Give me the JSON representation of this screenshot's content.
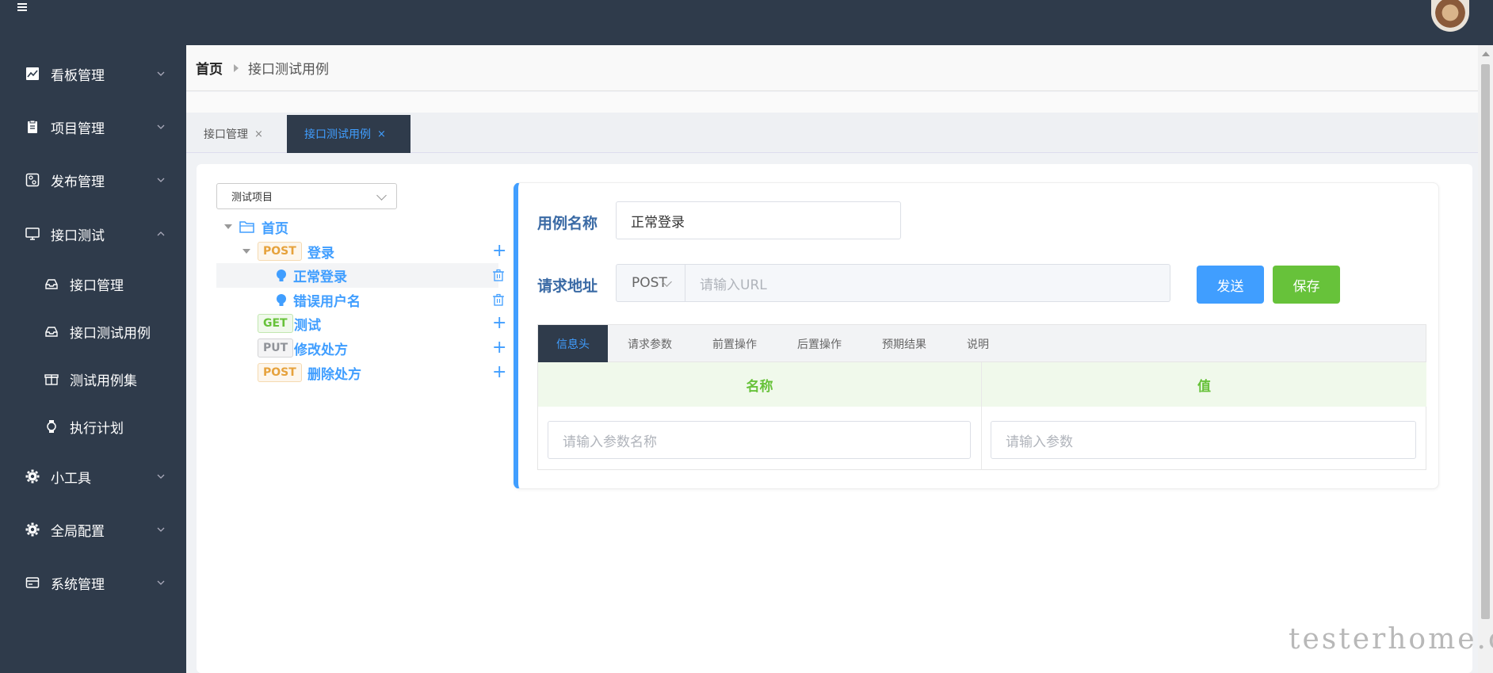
{
  "header": {
    "menu_icon": "hamburger-icon",
    "avatar": "user-avatar"
  },
  "sidebar": {
    "items": [
      {
        "label": "看板管理",
        "icon": "chart-icon",
        "expanded": false
      },
      {
        "label": "项目管理",
        "icon": "clipboard-icon",
        "expanded": false
      },
      {
        "label": "发布管理",
        "icon": "settings-panel-icon",
        "expanded": false
      },
      {
        "label": "接口测试",
        "icon": "monitor-icon",
        "expanded": true
      },
      {
        "label": "小工具",
        "icon": "gear-icon",
        "expanded": false
      },
      {
        "label": "全局配置",
        "icon": "gear-icon",
        "expanded": false
      },
      {
        "label": "系统管理",
        "icon": "card-icon",
        "expanded": false
      }
    ],
    "submenu": [
      {
        "label": "接口管理",
        "icon": "inbox-icon"
      },
      {
        "label": "接口测试用例",
        "icon": "inbox-icon"
      },
      {
        "label": "测试用例集",
        "icon": "gift-icon"
      },
      {
        "label": "执行计划",
        "icon": "watch-icon"
      }
    ]
  },
  "breadcrumb": {
    "home": "首页",
    "current": "接口测试用例"
  },
  "page_tabs": [
    {
      "label": "接口管理",
      "close": "×",
      "active": false
    },
    {
      "label": "接口测试用例",
      "close": "×",
      "active": true
    }
  ],
  "tree": {
    "project_select": "测试项目",
    "root": "首页",
    "nodes": [
      {
        "method": "POST",
        "label": "登录",
        "action": "+"
      },
      {
        "label": "正常登录",
        "action": "trash"
      },
      {
        "label": "错误用户名",
        "action": "trash"
      },
      {
        "method": "GET",
        "label": "测试",
        "action": "+"
      },
      {
        "method": "PUT",
        "label": "修改处方",
        "action": "+"
      },
      {
        "method": "POST",
        "label": "删除处方",
        "action": "+"
      }
    ]
  },
  "editor": {
    "case_name_label": "用例名称",
    "case_name_value": "正常登录",
    "url_label": "请求地址",
    "method_value": "POST",
    "url_placeholder": "请输入URL",
    "send_label": "发送",
    "save_label": "保存",
    "sub_tabs": [
      "信息头",
      "请求参数",
      "前置操作",
      "后置操作",
      "预期结果",
      "说明"
    ],
    "table": {
      "col_name": "名称",
      "col_value": "值",
      "name_placeholder": "请输入参数名称",
      "value_placeholder": "请输入参数"
    }
  },
  "watermark": "testerhome.com",
  "colors": {
    "sidebar_bg": "#2f3b4b",
    "accent": "#409eff",
    "success": "#67c23a",
    "warning": "#e6a23c"
  }
}
